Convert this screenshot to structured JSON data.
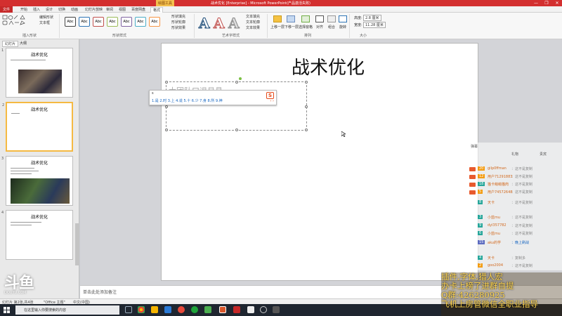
{
  "window": {
    "title": "战术优化 [Enterprise] - Microsoft PowerPoint(产品激活失败)",
    "context_tab": "绘图工具",
    "controls": [
      "—",
      "❐",
      "✕"
    ]
  },
  "tabs": [
    "文件",
    "开始",
    "插入",
    "设计",
    "切换",
    "动画",
    "幻灯片放映",
    "审阅",
    "视图",
    "百度网盘",
    "格式"
  ],
  "ribbon": {
    "insert_shapes_label": "插入形状",
    "edit_shape": "编辑形状",
    "text_box": "文本框",
    "shape_styles_label": "形状样式",
    "abc": "Abc",
    "shape_fill": "形状填充",
    "shape_outline": "形状轮廓",
    "shape_effects": "形状效果",
    "wordart_label": "艺术字样式",
    "wordart_glyph": "A",
    "text_fill": "文本填充",
    "text_outline": "文本轮廓",
    "text_effects": "文本效果",
    "arrange_label": "排列",
    "bring_forward": "上移一层",
    "send_backward": "下移一层",
    "selection_pane": "选择窗格",
    "align": "对齐",
    "group": "组合",
    "rotate": "旋转",
    "size_label": "大小",
    "height_label": "高度:",
    "height_value": "2.8 厘米",
    "width_label": "宽度:",
    "width_value": "11.28 厘米"
  },
  "left_pane": {
    "tabs": [
      "幻灯片",
      "大纲"
    ],
    "slides": [
      {
        "num": "1",
        "title": "战术优化"
      },
      {
        "num": "2",
        "title": "战术优化"
      },
      {
        "num": "3",
        "title": "战术优化"
      },
      {
        "num": "4",
        "title": "战术优化"
      }
    ]
  },
  "slide": {
    "title": "战术优化",
    "typed_text": "大团队口退易县"
  },
  "ime": {
    "pinyin": "s",
    "candidates": "1.是  2.时  3.上  4.说  5.十  6.少  7.身  8.所  9.神",
    "logo": "S",
    "arrows": "‹ ›"
  },
  "notes": {
    "placeholder": "单击此处添加备注"
  },
  "status_bar": {
    "slide_info": "幻灯片 第2张,共4张",
    "theme": "\"Office 主题\"",
    "language": "中文(中国)"
  },
  "taskbar": {
    "search_placeholder": "在这里输入你要搜索的内容"
  },
  "chat": {
    "header": [
      "弹幕",
      "礼物",
      "贵宾"
    ],
    "rows": [
      {
        "lvl": "20",
        "name": "gilp0ffman",
        "msg": "：这不是复制"
      },
      {
        "lvl": "12",
        "name": "用户71291883",
        "msg": "：这不是复制"
      },
      {
        "lvl": "18",
        "name": "猫卡萌萌猫肉",
        "msg": "：这不是复制"
      },
      {
        "lvl": "5",
        "name": "用户74572648",
        "msg": "：这不是复制"
      },
      {
        "lvl": "8",
        "name": "天卡",
        "msg": "：这不是复制"
      },
      {
        "lvl": "3",
        "name": "小蓝mu",
        "msg": "：这不是复制"
      },
      {
        "lvl": "9",
        "name": "dyl357782",
        "msg": "：这不是复制"
      },
      {
        "lvl": "6",
        "name": "小蓝mu",
        "msg": "：这不是复制"
      },
      {
        "lvl": "15",
        "name": "aku的学",
        "msg": "：晚上刷战"
      },
      {
        "lvl": "4",
        "name": "天卡",
        "msg": "：复制多"
      },
      {
        "lvl": "2",
        "name": "goo2004",
        "msg": "：这不是复制"
      }
    ]
  },
  "overlay": {
    "lines": [
      "插件,字体,猎人宏",
      "办卡上榜了进群自提",
      "Q群:426280925",
      "飞机上房管微信全职业指导"
    ]
  },
  "watermark": {
    "text": "斗鱼",
    "sub": "DOUYU.COM"
  }
}
